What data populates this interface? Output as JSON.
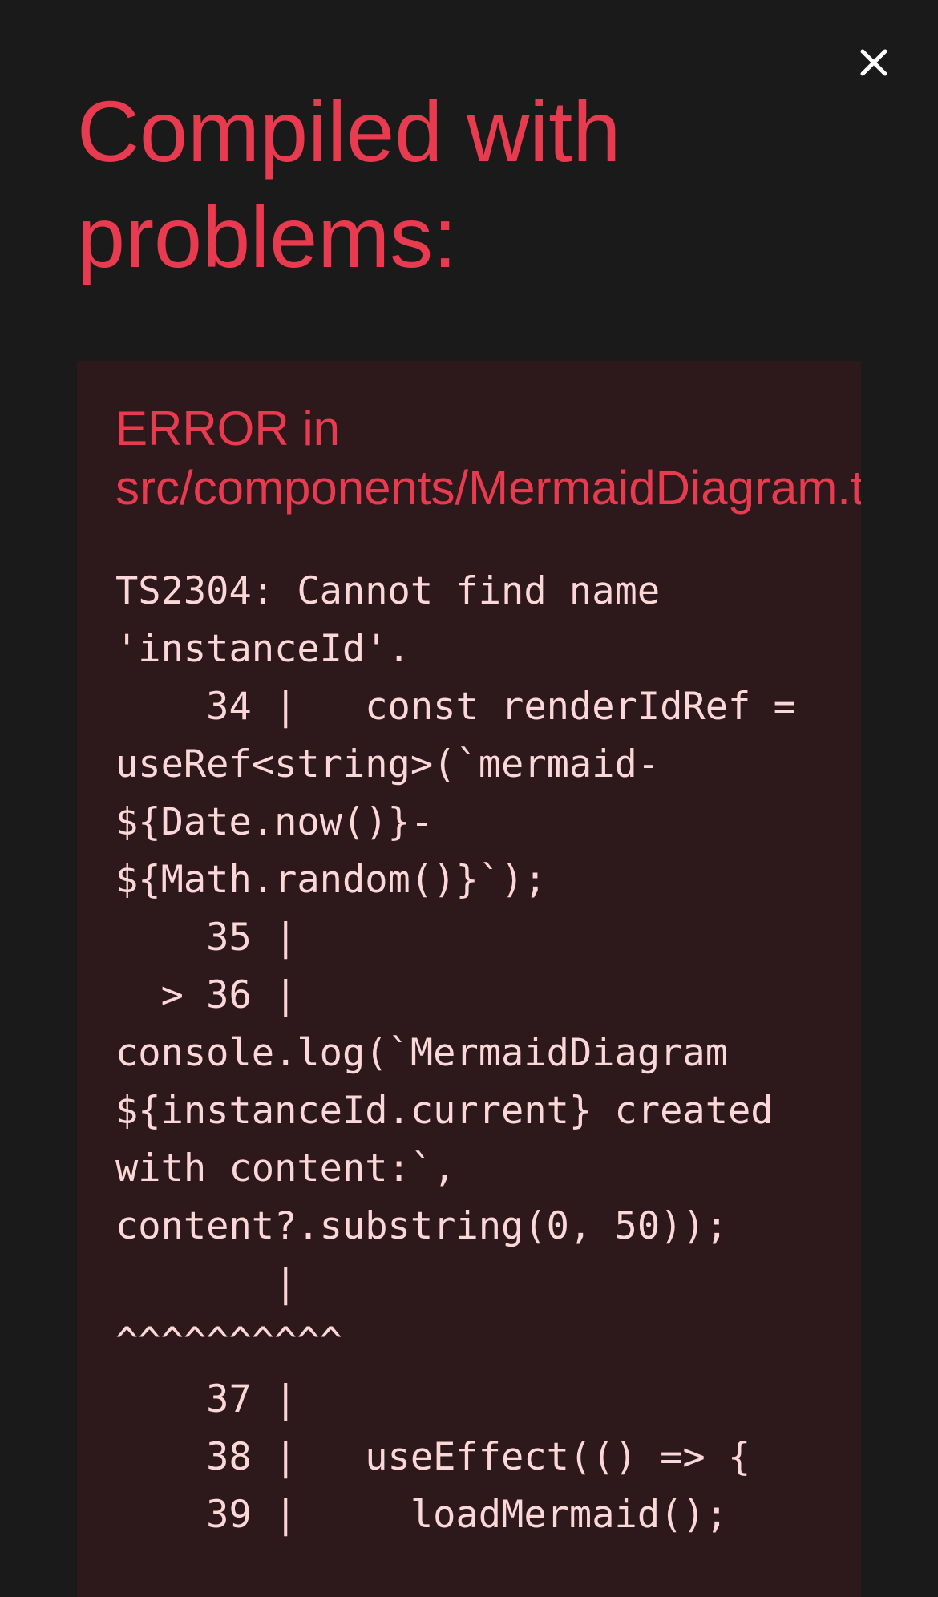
{
  "overlay": {
    "close_icon": "close-icon",
    "title": "Compiled with problems:"
  },
  "error": {
    "header_prefix": "ERROR in",
    "file_path": "src/components/MermaidDiagram.tsx",
    "message": "TS2304: Cannot find name\n'instanceId'.\n    34 |   const renderIdRef =\nuseRef<string>(`mermaid-\n${Date.now()}-\n${Math.random()}`);\n    35 |\n  > 36 |\nconsole.log(`MermaidDiagram\n${instanceId.current} created\nwith content:`,\ncontent?.substring(0, 50));\n       |\n^^^^^^^^^^\n    37 |\n    38 |   useEffect(() => {\n    39 |     loadMermaid();"
  },
  "colors": {
    "background": "#1a1a1a",
    "panel_background": "#2d181c",
    "error_red": "#e83b4f",
    "message_text": "#fcd7d7",
    "close_icon": "#ffffff"
  }
}
